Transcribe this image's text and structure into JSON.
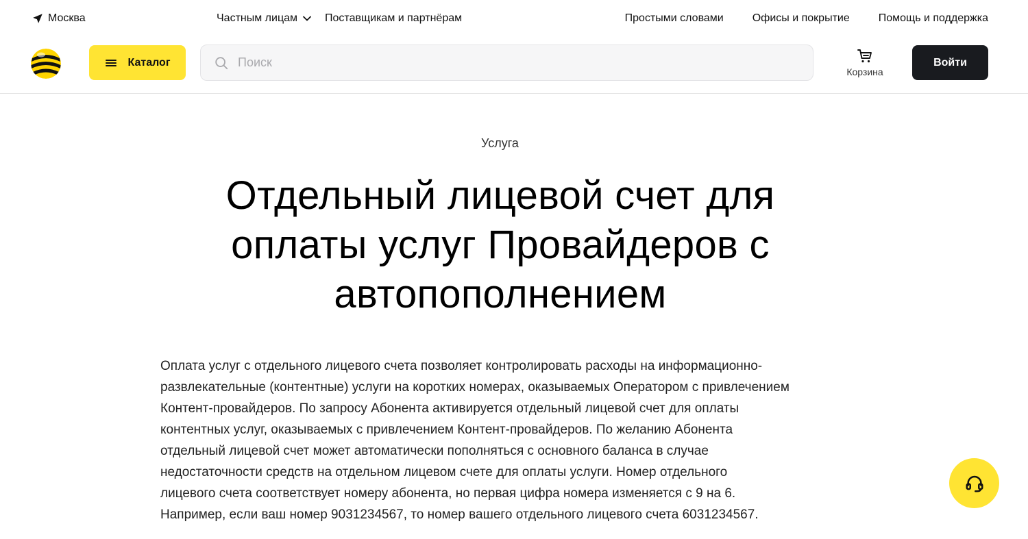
{
  "topbar": {
    "city": "Москва",
    "nav_left": [
      {
        "label": "Частным лицам"
      },
      {
        "label": "Поставщикам и партнёрам"
      }
    ],
    "nav_right": [
      {
        "label": "Простыми словами"
      },
      {
        "label": "Офисы и покрытие"
      },
      {
        "label": "Помощь и поддержка"
      }
    ]
  },
  "header": {
    "catalog_label": "Каталог",
    "search_placeholder": "Поиск",
    "cart_label": "Корзина",
    "login_label": "Войти"
  },
  "content": {
    "eyebrow": "Услуга",
    "title_lines": [
      "Отдельный лицевой счет для",
      "оплаты услуг Провайдеров с",
      "автопополнением"
    ],
    "description_lines": [
      "Оплата услуг с отдельного лицевого счета позволяет контролировать расходы на информационно-",
      "развлекательные (контентные) услуги на коротких номерах, оказываемых Оператором с привлечением",
      "Контент-провайдеров. По запросу Абонента  активируется отдельный лицевой счет для оплаты",
      "контентных услуг, оказываемых с привлечением Контент-провайдеров. По желанию Абонента",
      "отдельный лицевой счет может автоматически пополняться с основного баланса в случае",
      "недостаточности средств на отдельном лицевом счете для оплаты услуги. Номер отдельного",
      "лицевого счета соответствует номеру абонента, но первая цифра номера изменяется с 9  на 6.",
      "Например, если ваш номер 9031234567, то номер вашего отдельного лицевого счета 6031234567."
    ]
  },
  "icons": {
    "city": "location-arrow-icon",
    "nav_dropdown": "chevron-down-icon",
    "logo": "beeline-logo-icon",
    "catalog": "menu-icon",
    "search": "search-icon",
    "cart": "cart-icon",
    "support": "headset-icon"
  },
  "colors": {
    "brand_yellow": "#ffe433",
    "login_bg": "#191b1f",
    "text": "#111111"
  }
}
